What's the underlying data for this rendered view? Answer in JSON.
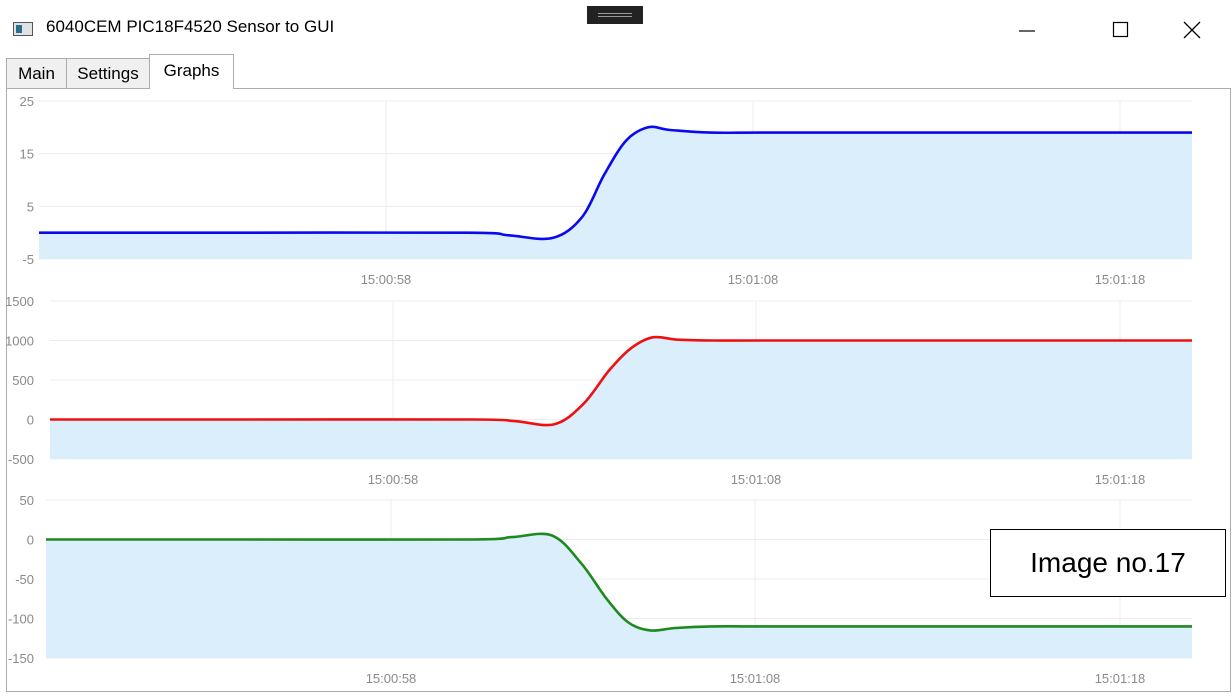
{
  "window": {
    "title": "6040CEM PIC18F4520 Sensor to GUI",
    "controls": [
      "minimize",
      "maximize",
      "close"
    ]
  },
  "tabs": [
    {
      "label": "Main",
      "active": false
    },
    {
      "label": "Settings",
      "active": false
    },
    {
      "label": "Graphs",
      "active": true
    }
  ],
  "annotation": "Image no.17",
  "chart_data": [
    {
      "type": "area",
      "color": "#0a0aee",
      "fill": "#dbeefc",
      "ylim": [
        -5,
        25
      ],
      "yticks": [
        25,
        15,
        5,
        -5
      ],
      "xticks": [
        "15:00:58",
        "15:01:08",
        "15:01:18"
      ],
      "grid": true,
      "x_sec": [
        0,
        5.5,
        11.7,
        12.8,
        14.0,
        14.8,
        15.4,
        16.0,
        16.6,
        17.2,
        18.3,
        20,
        27,
        43
      ],
      "values": [
        0,
        0,
        0,
        -0.5,
        -1,
        3,
        11,
        17.5,
        20,
        19.5,
        19,
        19,
        19,
        19
      ]
    },
    {
      "type": "area",
      "color": "#ee1111",
      "fill": "#dbeefc",
      "ylim": [
        -500,
        1500
      ],
      "yticks": [
        1500,
        1000,
        500,
        0,
        -500
      ],
      "xticks": [
        "15:00:58",
        "15:01:08",
        "15:01:18"
      ],
      "grid": true,
      "x_sec": [
        0,
        5.5,
        11.7,
        12.8,
        13.9,
        14.7,
        15.4,
        16.0,
        16.6,
        17.3,
        18.3,
        20,
        27,
        43
      ],
      "values": [
        0,
        0,
        0,
        -20,
        -60,
        200,
        620,
        900,
        1040,
        1010,
        1000,
        1000,
        1000,
        1000
      ]
    },
    {
      "type": "area",
      "color": "#1e8a1e",
      "fill": "#dbeefc",
      "ylim": [
        -150,
        50
      ],
      "yticks": [
        50,
        0,
        -50,
        -100,
        -150
      ],
      "xticks": [
        "15:00:58",
        "15:01:08",
        "15:01:18"
      ],
      "grid": true,
      "x_sec": [
        0,
        5.5,
        11.7,
        12.8,
        13.9,
        14.7,
        15.4,
        16.0,
        16.6,
        17.3,
        18.3,
        20,
        27,
        43
      ],
      "values": [
        0,
        0,
        0,
        3,
        5,
        -30,
        -75,
        -105,
        -115,
        -112,
        -110,
        -110,
        -110,
        -110
      ]
    }
  ]
}
